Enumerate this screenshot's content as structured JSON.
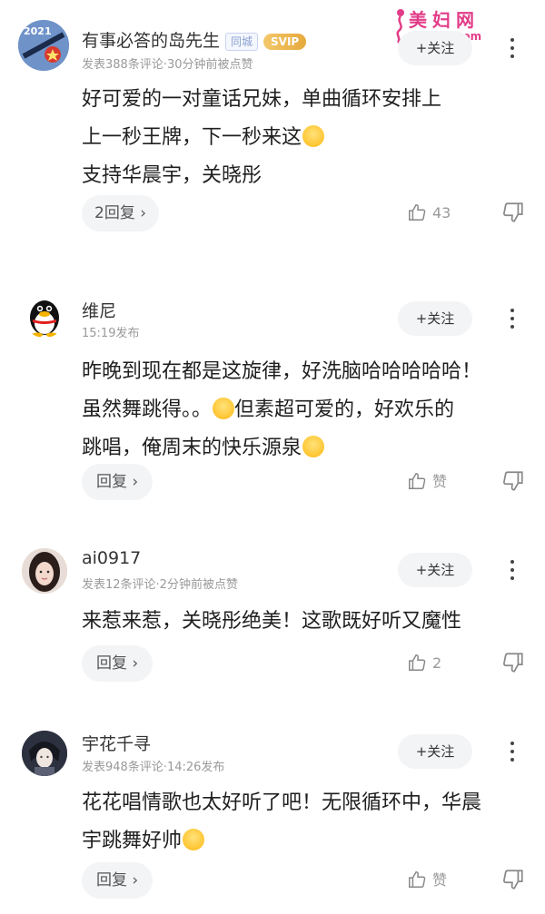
{
  "watermark": {
    "title": "美妇网",
    "url": "meili43.com"
  },
  "actions": {
    "follow_label": "+关注",
    "reply_label_prefix": "回复"
  },
  "comments": [
    {
      "username": "有事必答的岛先生",
      "avatar_text": "2021",
      "badges": [
        "同城",
        "SVIP"
      ],
      "meta": "发表388条评论·30分钟前被点赞",
      "lines": [
        "好可爱的一对童话兄妹，单曲循环安排上",
        "上一秒王牌，下一秒来这",
        "支持华晨宇，关晓彤"
      ],
      "reply_label": "2回复",
      "like_label": "43"
    },
    {
      "username": "维尼",
      "meta": "15:19发布",
      "lines": [
        "昨晚到现在都是这旋律，好洗脑哈哈哈哈哈！",
        "虽然舞跳得。。",
        "但素超可爱的，好欢乐的",
        "跳唱，俺周末的快乐源泉"
      ],
      "reply_label": "回复",
      "like_label": "赞"
    },
    {
      "username": "ai0917",
      "meta": "发表12条评论·2分钟前被点赞",
      "lines": [
        "来惹来惹，关晓彤绝美！这歌既好听又魔性"
      ],
      "reply_label": "回复",
      "like_label": "2"
    },
    {
      "username": "宇花千寻",
      "meta": "发表948条评论·14:26发布",
      "lines": [
        "花花唱情歌也太好听了吧！无限循环中，华晨",
        "宇跳舞好帅"
      ],
      "reply_label": "回复",
      "like_label": "赞"
    }
  ]
}
